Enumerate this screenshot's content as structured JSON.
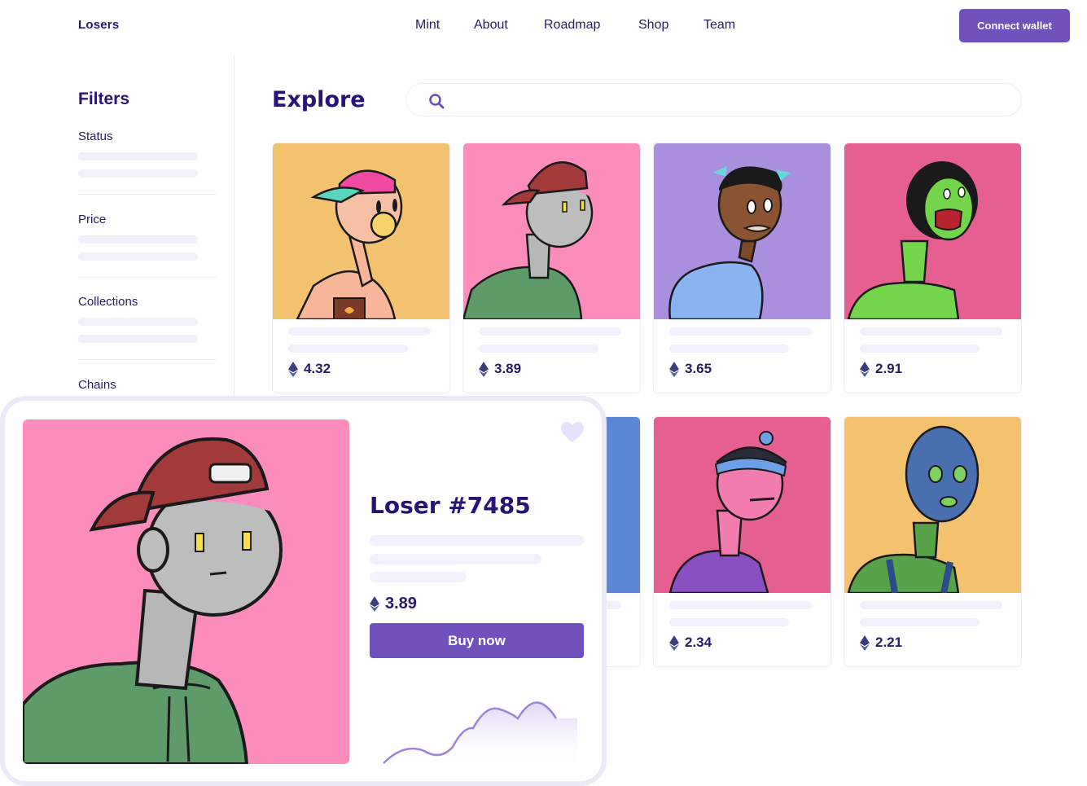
{
  "header": {
    "logo": "Losers",
    "nav": [
      "Mint",
      "About",
      "Roadmap",
      "Shop",
      "Team"
    ],
    "connect_label": "Connect wallet"
  },
  "sidebar": {
    "title": "Filters",
    "groups": [
      "Status",
      "Price",
      "Collections",
      "Chains"
    ]
  },
  "main": {
    "title": "Explore",
    "search": {
      "value": "",
      "placeholder": ""
    },
    "cards": [
      {
        "price": "4.32",
        "bg": "#f3c26f"
      },
      {
        "price": "3.89",
        "bg": "#fb8cbc"
      },
      {
        "price": "3.65",
        "bg": "#a98fde"
      },
      {
        "price": "2.91",
        "bg": "#e55f91"
      },
      {
        "price": "",
        "bg": "#5c86d6"
      },
      {
        "price": "2.34",
        "bg": "#e55f91"
      },
      {
        "price": "2.21",
        "bg": "#f3c26f"
      }
    ]
  },
  "detail": {
    "title": "Loser #7485",
    "price": "3.89",
    "buy_label": "Buy now",
    "bg": "#fb8cbc"
  },
  "colors": {
    "accent": "#7152bd",
    "heading": "#2a1377",
    "skeleton": "#f2f0fa",
    "eth": "#3d3b7a"
  }
}
